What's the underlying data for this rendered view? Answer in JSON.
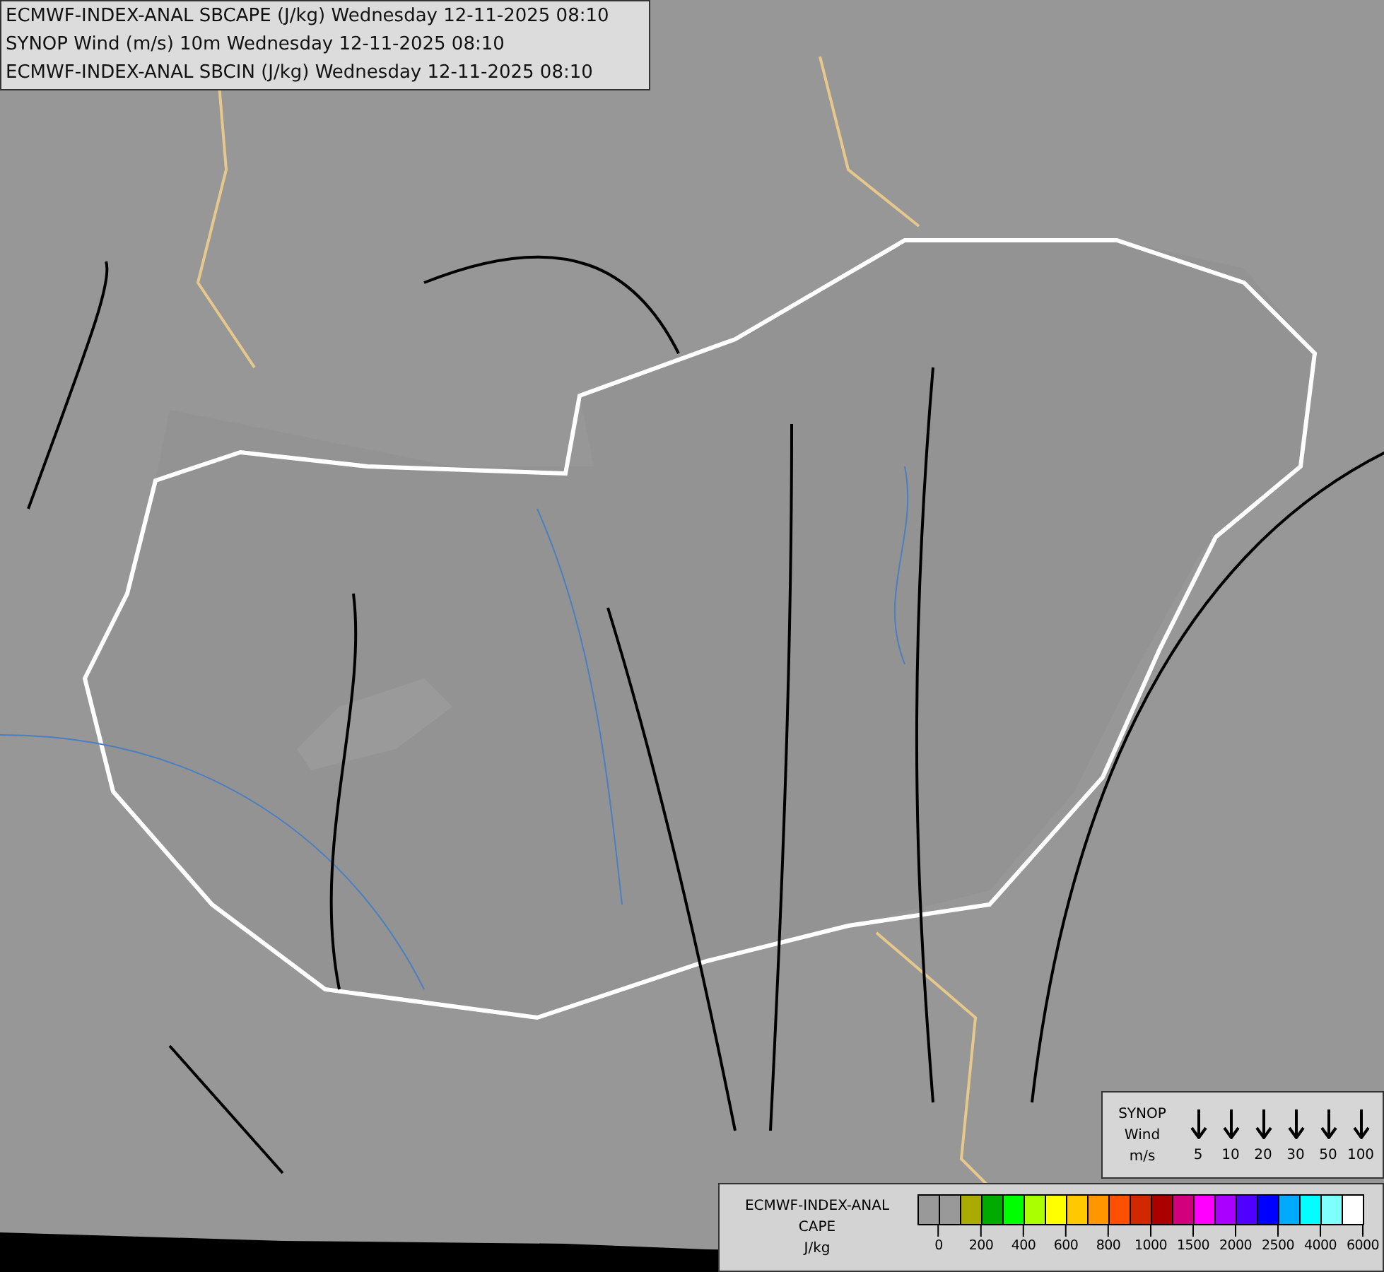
{
  "header": {
    "lines": [
      "ECMWF-INDEX-ANAL SBCAPE (J/kg) Wednesday 12-11-2025 08:10",
      "SYNOP Wind (m/s) 10m Wednesday 12-11-2025 08:10",
      "ECMWF-INDEX-ANAL SBCIN (J/kg) Wednesday 12-11-2025 08:10"
    ]
  },
  "wind_legend": {
    "title_lines": [
      "SYNOP",
      "Wind",
      "m/s"
    ],
    "speeds": [
      "5",
      "10",
      "20",
      "30",
      "50",
      "100"
    ]
  },
  "cape_legend": {
    "title_lines": [
      "ECMWF-INDEX-ANAL",
      "CAPE",
      "J/kg"
    ],
    "swatches": [
      {
        "color": "#999999"
      },
      {
        "color": "#999999"
      },
      {
        "color": "#aaaa00"
      },
      {
        "color": "#00aa00"
      },
      {
        "color": "#00ff00"
      },
      {
        "color": "#aaff00"
      },
      {
        "color": "#ffff00"
      },
      {
        "color": "#ffc800"
      },
      {
        "color": "#ff9600"
      },
      {
        "color": "#ff5000"
      },
      {
        "color": "#d22800"
      },
      {
        "color": "#aa0000"
      },
      {
        "color": "#d2007d"
      },
      {
        "color": "#ff00ff"
      },
      {
        "color": "#aa00ff"
      },
      {
        "color": "#5000ff"
      },
      {
        "color": "#0000ff"
      },
      {
        "color": "#00aaff"
      },
      {
        "color": "#00ffff"
      },
      {
        "color": "#80ffff"
      },
      {
        "color": "#ffffff"
      }
    ],
    "ticks": [
      "0",
      "200",
      "400",
      "600",
      "800",
      "1000",
      "1500",
      "2000",
      "2500",
      "4000",
      "6000"
    ]
  }
}
